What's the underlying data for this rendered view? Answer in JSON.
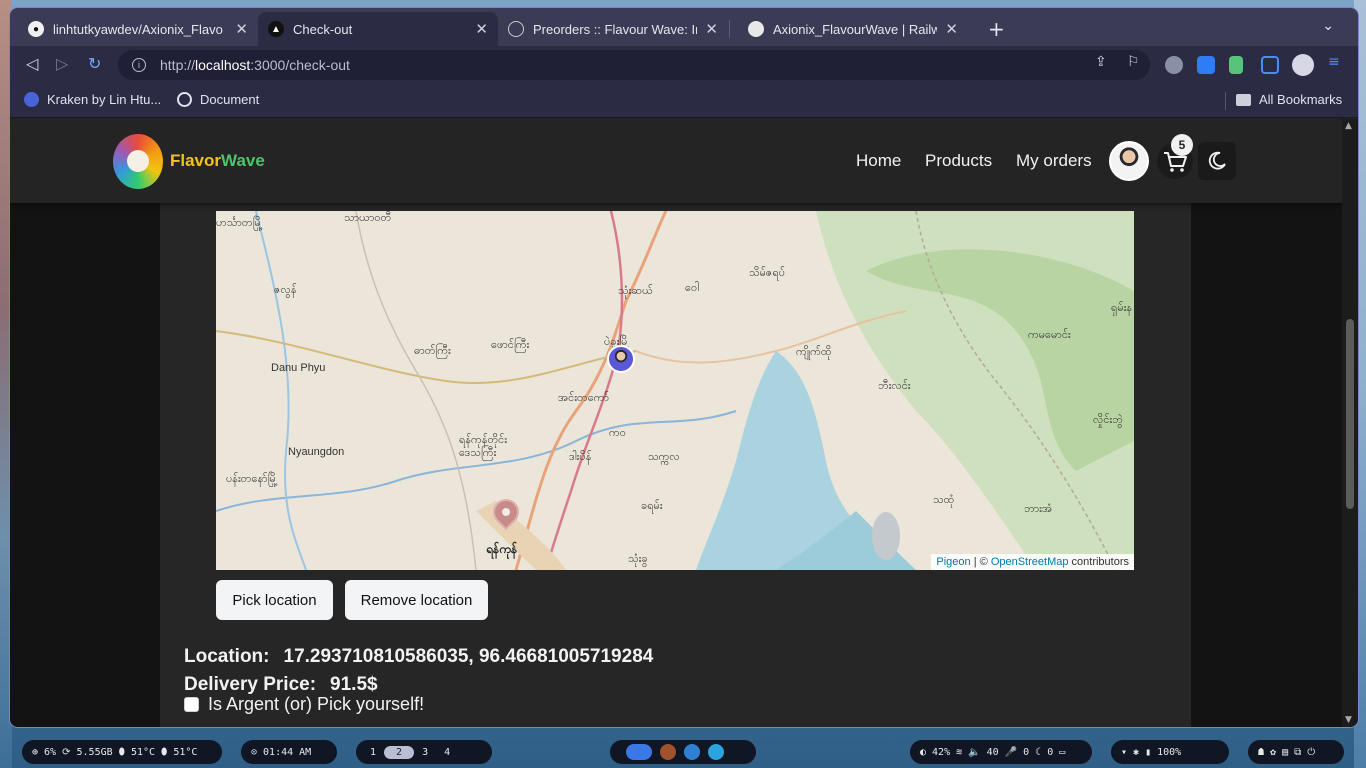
{
  "browser": {
    "tabs": [
      {
        "label": "linhtutkyawdev/Axionix_Flavo",
        "active": false
      },
      {
        "label": "Check-out",
        "active": true
      },
      {
        "label": "Preorders :: Flavour Wave: Int",
        "active": false
      },
      {
        "label": "Axionix_FlavourWave | Railwa",
        "active": false
      }
    ],
    "url_prefix": "http://",
    "url_host": "localhost",
    "url_path": ":3000/check-out",
    "bookmarks": [
      "Kraken by Lin Htu...",
      "Document"
    ],
    "all_bookmarks": "All Bookmarks"
  },
  "site": {
    "brand_first": "Flavor",
    "brand_second": "Wave",
    "nav": [
      "Home",
      "Products",
      "My orders"
    ],
    "cart_count": "5"
  },
  "map": {
    "labels": [
      "ဟင်္သာတမြို့",
      "သာယာဝတီ",
      "ဇလွန်",
      "Danu Phyu",
      "ဓာတ်ကြီး",
      "ဖောင်ကြီး",
      "ပဲခူးမြို့",
      "သုံးဆယ်",
      "ဝေါ",
      "သိမ်ဇရပ်",
      "ကျိုက်ထို",
      "ကမမောင်း",
      "ဘီးလင်း",
      "အင်းတကော်",
      "ကဝ",
      "ရန်ကုန်တိုင်း ဒေသကြီး",
      "ဒါးပိန်",
      "သက္ကလ",
      "Nyaungdon",
      "ပန်းတနော်မြို့",
      "ခရမ်း",
      "ရန်ကုန်",
      "သထုံ",
      "ဘားအံ",
      "လှိုင်းဘွဲ",
      "သုံးခွ",
      "ရှမ်းန"
    ],
    "attribution_lib": "Pigeon",
    "attribution_sep": " | © ",
    "attribution_osm": "OpenStreetMap",
    "attribution_tail": " contributors"
  },
  "checkout": {
    "pick_location": "Pick location",
    "remove_location": "Remove location",
    "location_label": "Location:",
    "location_value": "17.29371081058603­5, 96.46681005719284",
    "delivery_label": "Delivery Price:",
    "delivery_value": "91.5$",
    "urgent_label": "Is Argent (or) Pick yourself!"
  },
  "taskbar": {
    "system": "⊕ 6%  ⟳ 5.55GB  ⬮ 51°C  ⬮ 51°C",
    "clock": "⊙ 01:44 AM",
    "workspaces": [
      "1",
      "2",
      "3",
      "4"
    ],
    "status": "◐ 42%  ≋  🔈 40  🎤 0  ☾ 0  ▭",
    "battery": "▾  ✱  ▮ 100%"
  },
  "colors": {
    "brand_yellow": "#f0c419",
    "brand_green": "#4cc46a",
    "page_bg": "#131313",
    "card_bg": "#262626"
  }
}
